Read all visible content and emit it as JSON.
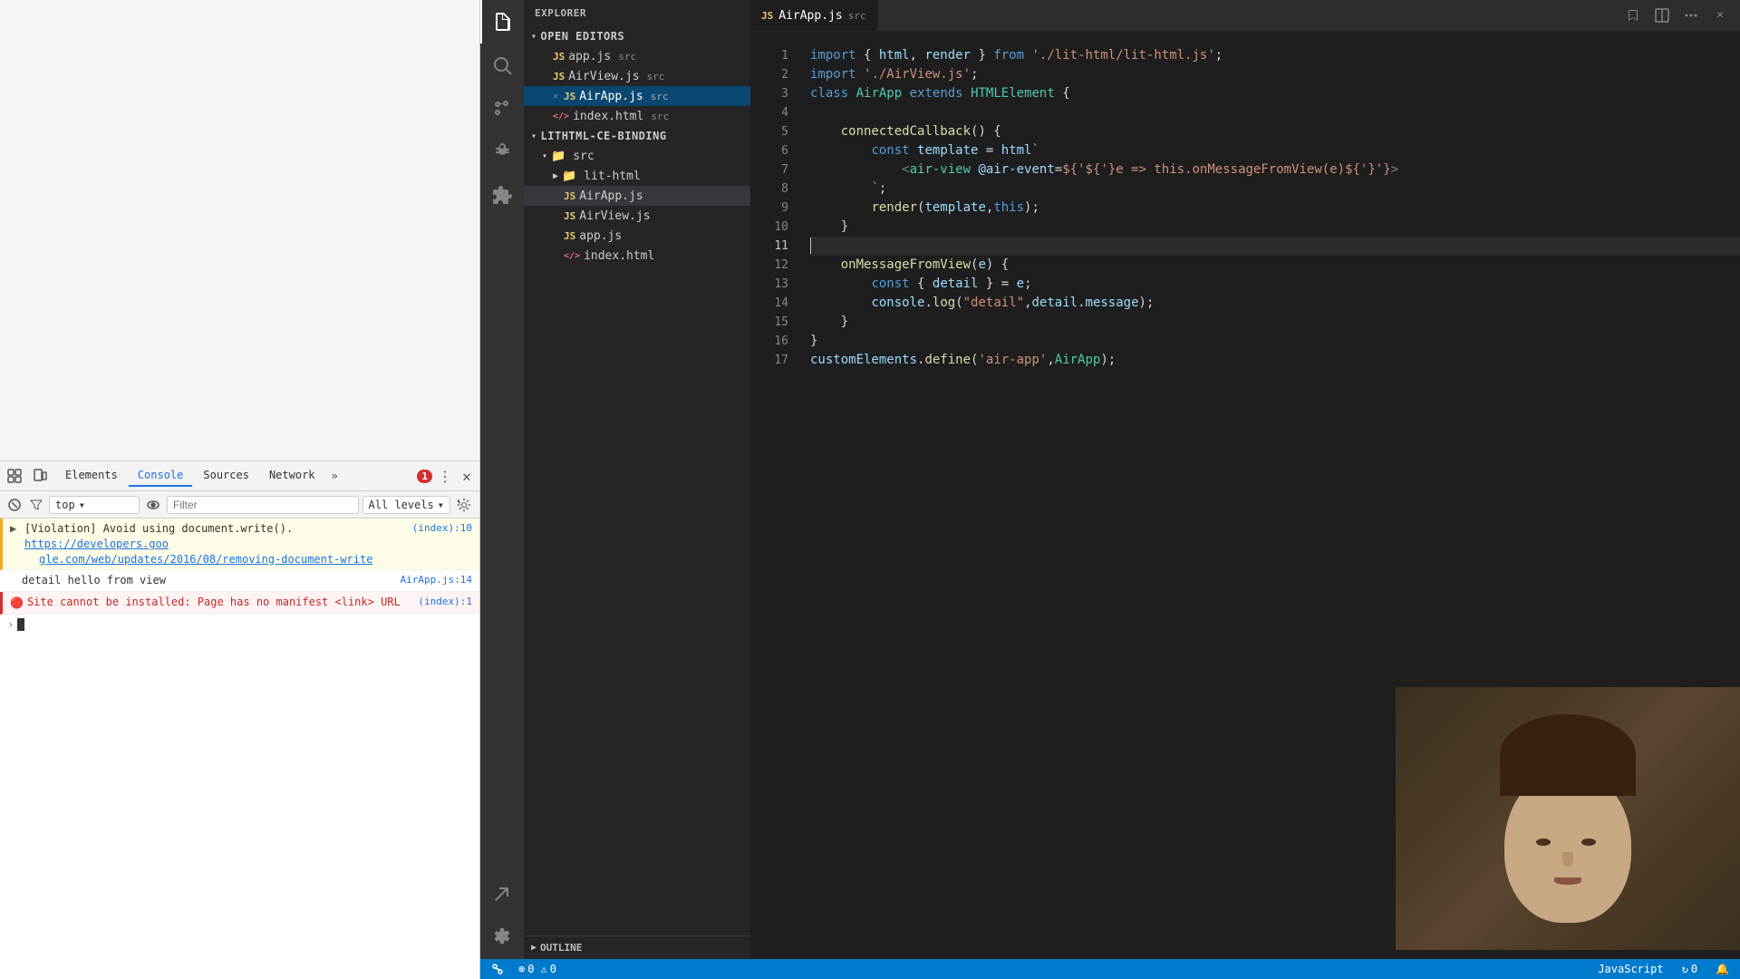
{
  "devtools": {
    "tabs": [
      "Elements",
      "Console",
      "Sources",
      "Network"
    ],
    "active_tab": "Console",
    "more_label": "»",
    "error_count": "1",
    "context_value": "top",
    "filter_placeholder": "Filter",
    "level_label": "All levels",
    "console_entries": [
      {
        "type": "warning",
        "icon": "▶",
        "text": "[Violation] Avoid using document.write().",
        "link_text": "https://developers.goo",
        "link_rest": "gle.com/web/updates/2016/08/removing-document-write",
        "source": "(index):10",
        "has_expand": true
      },
      {
        "type": "info",
        "text": "detail hello from view",
        "source": "AirApp.js:14"
      },
      {
        "type": "error",
        "icon": "🔴",
        "text": "Site cannot be installed: Page has no manifest <link> URL",
        "source": "(index):1"
      }
    ]
  },
  "vscode": {
    "activity_icons": [
      "files",
      "search",
      "source-control",
      "debug",
      "extensions",
      "testing",
      "settings"
    ],
    "explorer_title": "EXPLORER",
    "sidebar_sections": {
      "open_editors": {
        "label": "OPEN EDITORS",
        "files": [
          {
            "name": "app.js",
            "tag": "src",
            "type": "js",
            "has_close": false
          },
          {
            "name": "AirView.js",
            "tag": "src",
            "type": "js",
            "has_close": false
          },
          {
            "name": "AirApp.js",
            "tag": "src",
            "type": "js",
            "has_close": true,
            "active": true
          },
          {
            "name": "index.html",
            "tag": "src",
            "type": "html",
            "has_close": false
          }
        ]
      },
      "project": {
        "label": "LITHTML-CE-BINDING",
        "items": [
          {
            "name": "src",
            "type": "folder",
            "expanded": true
          },
          {
            "name": "lit-html",
            "type": "folder",
            "expanded": false,
            "indent": 1
          },
          {
            "name": "AirApp.js",
            "type": "js",
            "indent": 2,
            "active": true
          },
          {
            "name": "AirView.js",
            "type": "js",
            "indent": 2
          },
          {
            "name": "app.js",
            "type": "js",
            "indent": 2
          },
          {
            "name": "index.html",
            "type": "html",
            "indent": 2
          }
        ]
      }
    },
    "editor": {
      "tab_title": "AirApp.js",
      "tab_src": "src",
      "lines": [
        {
          "num": 1,
          "code": "import { html, render } from './lit-html/lit-html.js';"
        },
        {
          "num": 2,
          "code": "import './AirView.js';"
        },
        {
          "num": 3,
          "code": "class AirApp extends HTMLElement {"
        },
        {
          "num": 4,
          "code": ""
        },
        {
          "num": 5,
          "code": "    connectedCallback() {"
        },
        {
          "num": 6,
          "code": "        const template = html`"
        },
        {
          "num": 7,
          "code": "            <air-view @air-event=${e => this.onMessageFromView(e)}>"
        },
        {
          "num": 8,
          "code": "        `;"
        },
        {
          "num": 9,
          "code": "        render(template,this);"
        },
        {
          "num": 10,
          "code": "    }"
        },
        {
          "num": 11,
          "code": ""
        },
        {
          "num": 12,
          "code": "    onMessageFromView(e) {"
        },
        {
          "num": 13,
          "code": "        const { detail } = e;"
        },
        {
          "num": 14,
          "code": "        console.log(\"detail\",detail.message);"
        },
        {
          "num": 15,
          "code": "    }"
        },
        {
          "num": 16,
          "code": "}"
        },
        {
          "num": 17,
          "code": "customElements.define('air-app',AirApp);"
        }
      ]
    },
    "outline_label": "OUTLINE",
    "bottom_bar": {
      "errors": "0",
      "warnings": "0",
      "language": "JavaScript",
      "git_sync": "↻ 0",
      "bell": "🔔"
    }
  }
}
